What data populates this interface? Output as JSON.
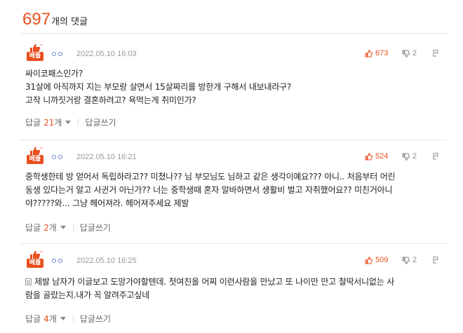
{
  "header": {
    "count": "697",
    "suffix": "개의 댓글"
  },
  "colors": {
    "accent": "#e8501d",
    "dots": "#6b83c9"
  },
  "comments": [
    {
      "badge": "베플",
      "date": "2022.05.10 16:03",
      "likes": "673",
      "dislikes": "2",
      "lines": [
        "싸이코패스인가?",
        "31살에 아직까지 지는 부모랑 살면서 15살짜리를 방한개 구해서 내보내라구?",
        "고작 니까짓거랑 결혼하려고? 욕먹는게 취미인가?"
      ],
      "reply_label": "답글",
      "reply_count": "21",
      "reply_unit": "개",
      "write_label": "답글쓰기"
    },
    {
      "badge": "베플",
      "date": "2022.05.10 16:21",
      "likes": "524",
      "dislikes": "2",
      "lines": [
        "중학생한테 방 얻어서 독립하라고?? 미쳤나?? 님 부모님도 님하고 같은 생각이예요??? 아니.. 처음부터 어린",
        "동생 있다는거 알고 사귄거 아닌가?? 너는 중학생때 혼자 알바하면서 생활비 벌고 자취했어요?? 미친거아니",
        "야?????와... 그냥 헤어져라. 헤어져주세요 제발"
      ],
      "reply_label": "답글",
      "reply_count": "2",
      "reply_unit": "개",
      "write_label": "답글쓰기"
    },
    {
      "badge": "베플",
      "date": "2022.05.10 16:25",
      "likes": "509",
      "dislikes": "2",
      "lines": [
        "제발 남자가 이글보고 도망가야할텐데. 첫여친을 어찌 이런사람을 만났고 또 나이만 만고 철딱서니없는 사",
        "람을 골랐는지.내가 꼭 알려주고싶네"
      ],
      "reply_label": "답글",
      "reply_count": "4",
      "reply_unit": "개",
      "write_label": "답글쓰기"
    }
  ]
}
